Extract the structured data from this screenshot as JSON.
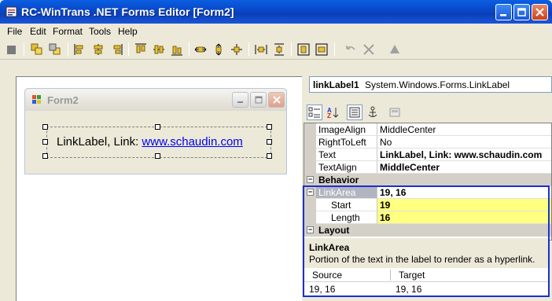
{
  "window": {
    "title": "RC-WinTrans .NET Forms Editor [Form2]"
  },
  "menu": {
    "file": "File",
    "edit": "Edit",
    "format": "Format",
    "tools": "Tools",
    "help": "Help"
  },
  "design": {
    "form_title": "Form2",
    "link_prefix": "LinkLabel,  Link: ",
    "link_url": "www.schaudin.com"
  },
  "props": {
    "object_name": "linkLabel1",
    "object_type": "System.Windows.Forms.LinkLabel",
    "rows": [
      {
        "name": "ImageAlign",
        "value": "MiddleCenter"
      },
      {
        "name": "RightToLeft",
        "value": "No"
      },
      {
        "name": "Text",
        "value": "LinkLabel,  Link:  www.schaudin.com"
      },
      {
        "name": "TextAlign",
        "value": "MiddleCenter"
      }
    ],
    "cat_behavior": "Behavior",
    "linkarea": {
      "name": "LinkArea",
      "value": "19, 16"
    },
    "start": {
      "name": "Start",
      "value": "19"
    },
    "length": {
      "name": "Length",
      "value": "16"
    },
    "cat_layout": "Layout",
    "desc_title": "LinkArea",
    "desc_text": "Portion of the text in the label to render as a hyperlink.",
    "src_header": "Source",
    "tgt_header": "Target",
    "src_value": "19, 16",
    "tgt_value": "19, 16"
  },
  "colors": {
    "selection_border": "#1c2fd0",
    "highlight_yellow": "#ffff80",
    "title_blue": "#0a47c8"
  }
}
